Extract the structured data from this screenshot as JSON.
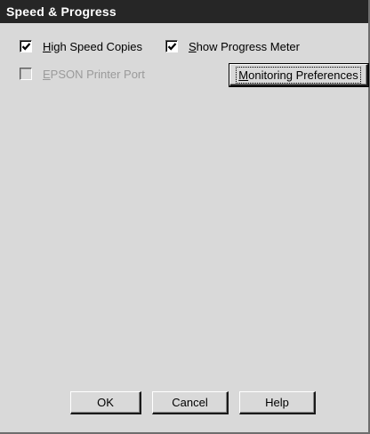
{
  "dialog": {
    "title": "Speed & Progress"
  },
  "options": {
    "high_speed_copies": {
      "label": "High Speed Copies",
      "checked": true,
      "enabled": true
    },
    "show_progress_meter": {
      "label": "Show Progress Meter",
      "checked": true,
      "enabled": true
    },
    "epson_printer_port": {
      "label": "EPSON Printer Port",
      "checked": false,
      "enabled": false
    }
  },
  "buttons": {
    "monitoring_preferences": "Monitoring Preferences",
    "ok": "OK",
    "cancel": "Cancel",
    "help": "Help"
  },
  "icons": {
    "checkmark": "check-icon"
  },
  "colors": {
    "title_bar": "#262626",
    "dialog_bg": "#d9d9d9",
    "disabled_text": "#9a9a9a"
  }
}
